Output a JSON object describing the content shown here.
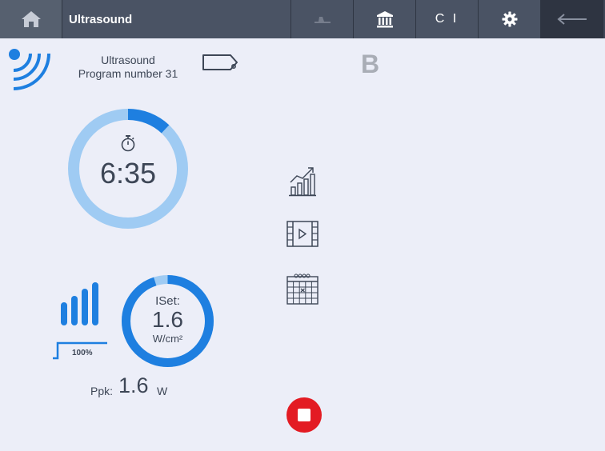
{
  "header": {
    "title": "Ultrasound",
    "ci_label": "C I"
  },
  "program": {
    "line1": "Ultrasound",
    "line2": "Program number 31",
    "mode": "B"
  },
  "timer": {
    "value": "6:35",
    "progress_fraction": 0.12
  },
  "intensity": {
    "label": "ISet:",
    "value": "1.6",
    "unit": "W/cm²",
    "progress_fraction": 0.95,
    "duty_percent": "100%"
  },
  "power": {
    "label": "Ppk:",
    "value": "1.6",
    "unit": "W"
  },
  "colors": {
    "accent_blue": "#1e7fe0",
    "light_blue": "#9fcbf3",
    "stop_red": "#e31b23",
    "background": "#eceef8"
  },
  "icons": {
    "home": "home-icon",
    "applicator": "applicator-icon",
    "library": "library-icon",
    "settings": "gear-icon",
    "back": "back-arrow-icon",
    "ultrasound": "ultrasound-waves-icon",
    "head": "transducer-head-icon",
    "chart": "chart-icon",
    "video": "video-icon",
    "calendar": "calendar-icon",
    "stop": "stop-icon"
  }
}
